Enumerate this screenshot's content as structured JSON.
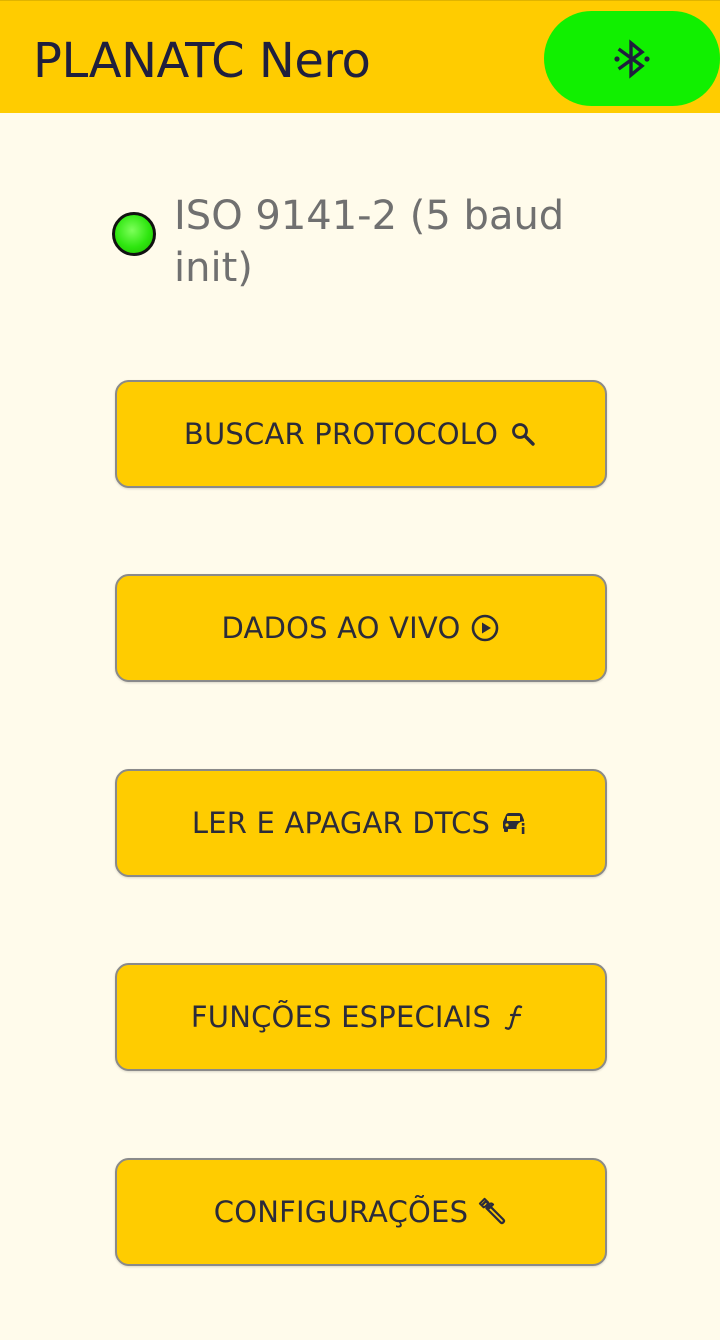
{
  "app": {
    "title": "PLANATC Nero",
    "bar_color": "#ffcc00",
    "bluetooth_button_color": "#11f000",
    "bluetooth_icon": "bluetooth-connected-icon"
  },
  "status": {
    "protocol": "ISO 9141-2 (5 baud init)",
    "indicator_color": "#2ee60f",
    "indicator_icon": "status-led-icon"
  },
  "menu": {
    "search_protocol": {
      "label": "BUSCAR PROTOCOLO",
      "icon": "search-icon"
    },
    "live_data": {
      "label": "DADOS AO VIVO",
      "icon": "play-circle-icon"
    },
    "dtcs": {
      "label": "LER E APAGAR DTCS",
      "icon": "car-info-icon"
    },
    "special_functions": {
      "label": "FUNÇÕES ESPECIAIS",
      "icon": "function-icon"
    },
    "settings": {
      "label": "CONFIGURAÇÕES",
      "icon": "wrench-icon"
    }
  }
}
